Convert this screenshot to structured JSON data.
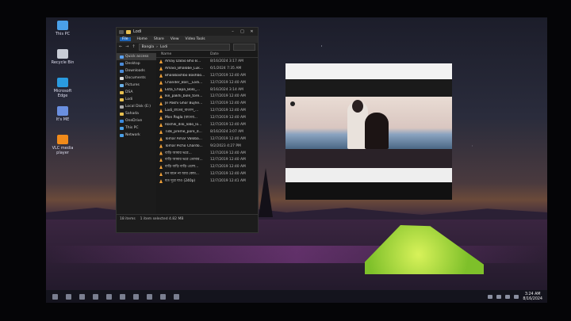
{
  "desktop": {
    "icons": [
      {
        "label": "This PC",
        "icon": "computer-icon",
        "color": "#4aa0e8"
      },
      {
        "label": "Recycle Bin",
        "icon": "recycle-bin-icon",
        "color": "#c8ccd6"
      },
      {
        "label": "Microsoft Edge",
        "icon": "edge-icon",
        "color": "#2a9be0"
      },
      {
        "label": "It's ME",
        "icon": "star-icon",
        "color": "#6a8fe0"
      },
      {
        "label": "VLC media player",
        "icon": "vlc-icon",
        "color": "#f08a1a"
      }
    ]
  },
  "explorer": {
    "title": "Lodi",
    "ribbon": {
      "file": "File",
      "home": "Home",
      "share": "Share",
      "view": "View",
      "video_tools": "Video Tools"
    },
    "nav": {
      "back": "←",
      "forward": "→",
      "up": "↑"
    },
    "breadcrumb": [
      "Bangla",
      "Lodi"
    ],
    "columns": {
      "name": "Name",
      "date": "Date"
    },
    "sidebar": [
      {
        "label": "Quick access",
        "icon": "star-icon",
        "color": "#5aa0f0",
        "selected": true
      },
      {
        "label": "Desktop",
        "icon": "desktop-icon",
        "color": "#4a8ad8"
      },
      {
        "label": "Downloads",
        "icon": "download-icon",
        "color": "#4a8ad8"
      },
      {
        "label": "Documents",
        "icon": "document-icon",
        "color": "#d8d8d8"
      },
      {
        "label": "Pictures",
        "icon": "pictures-icon",
        "color": "#6ab0e8"
      },
      {
        "label": "DSA",
        "icon": "folder-icon",
        "color": "#e8c050"
      },
      {
        "label": "Lodi",
        "icon": "folder-icon",
        "color": "#e8c050"
      },
      {
        "label": "Local Disk (E:)",
        "icon": "drive-icon",
        "color": "#aaaaaa"
      },
      {
        "label": "Sahada",
        "icon": "folder-icon",
        "color": "#e8c050"
      },
      {
        "label": "OneDrive",
        "icon": "onedrive-icon",
        "color": "#3a8ae0"
      },
      {
        "label": "This PC",
        "icon": "computer-icon",
        "color": "#4aa0e8"
      },
      {
        "label": "Network",
        "icon": "network-icon",
        "color": "#4aa0e8"
      }
    ],
    "files": [
      {
        "name": "Amay Dalao Bho B...",
        "date": "8/16/2024 3:17 AM"
      },
      {
        "name": "Amaio_Bhalobe_Luk...",
        "date": "6/1/2024 7:35 AM"
      },
      {
        "name": "Bhalobashbo Bashbo...",
        "date": "12/7/2019 12:40 AM"
      },
      {
        "name": "Chander_Bari__Lodi...",
        "date": "12/7/2019 12:40 AM"
      },
      {
        "name": "Ekta_Chapa_Bolo_...",
        "date": "8/16/2024 3:14 AM"
      },
      {
        "name": "Ike_pakhi_bole_tore...",
        "date": "12/7/2019 12:40 AM"
      },
      {
        "name": "Je Pakhi Ghor Bujhe...",
        "date": "12/7/2019 12:40 AM"
      },
      {
        "name": "Lodi_রাতের_বাতাস_...",
        "date": "12/7/2019 12:40 AM"
      },
      {
        "name": "Mon Pagla (রাতের...",
        "date": "12/7/2019 12:40 AM"
      },
      {
        "name": "Roshik_dilo_lobo_lo...",
        "date": "12/7/2019 12:40 AM"
      },
      {
        "name": "Tidk_preme_pore_d...",
        "date": "8/16/2024 3:07 AM"
      },
      {
        "name": "Tomar Amar Valoba...",
        "date": "12/7/2019 12:40 AM"
      },
      {
        "name": "Tomar Picho Chardo...",
        "date": "9/2/2023 4:27 PM"
      },
      {
        "name": "বাড়ি আমার ভরে...",
        "date": "12/7/2019 12:40 AM"
      },
      {
        "name": "বাড়ি আমার ভরে তোমার...",
        "date": "12/7/2019 12:40 AM"
      },
      {
        "name": "বাড়ি বাড়ি বাড়ি এলো...",
        "date": "12/7/2019 12:40 AM"
      },
      {
        "name": "মন মানে না আর কোম...",
        "date": "12/7/2019 12:40 AM"
      },
      {
        "name": "যত দূরে যাও (240p)",
        "date": "12/7/2019 12:41 AM"
      }
    ],
    "status": {
      "count": "18 items",
      "selection": "1 item selected  4.82 MB"
    }
  },
  "taskbar": {
    "icons": [
      "start-icon",
      "search-icon",
      "task-view-icon",
      "explorer-icon",
      "edge-icon",
      "store-icon",
      "chrome-icon",
      "mail-icon",
      "vlc-icon",
      "settings-icon"
    ],
    "clock": {
      "time": "3:24 AM",
      "date": "8/16/2024"
    }
  }
}
